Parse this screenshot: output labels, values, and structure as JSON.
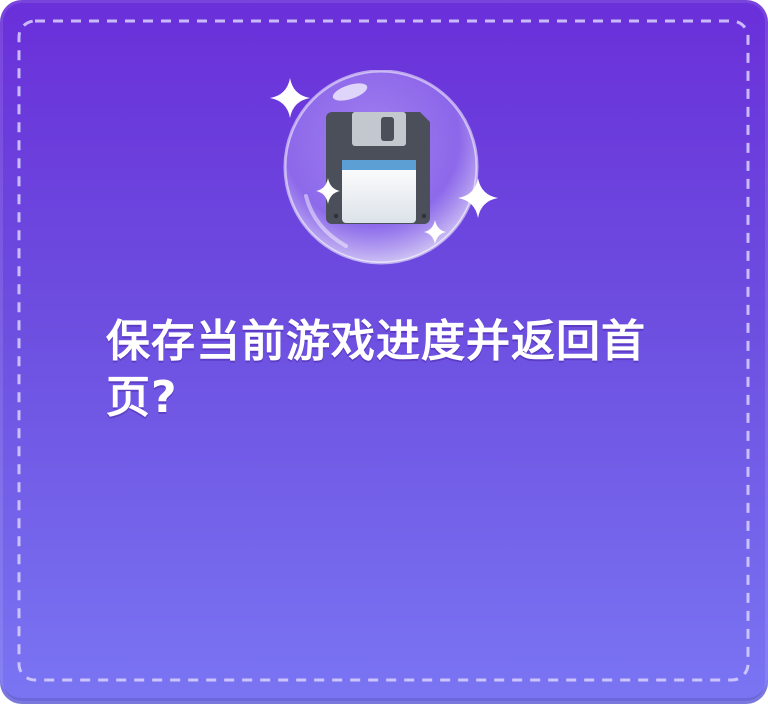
{
  "dialog": {
    "message": "保存当前游戏进度并返回首页?",
    "icon": "floppy-disk-save-icon",
    "decoration": "sparkle-icon"
  },
  "colors": {
    "background_top": "#6a2fd9",
    "background_bottom": "#7a75f3",
    "dash": "#d9d2ff",
    "text": "#ffffff"
  }
}
